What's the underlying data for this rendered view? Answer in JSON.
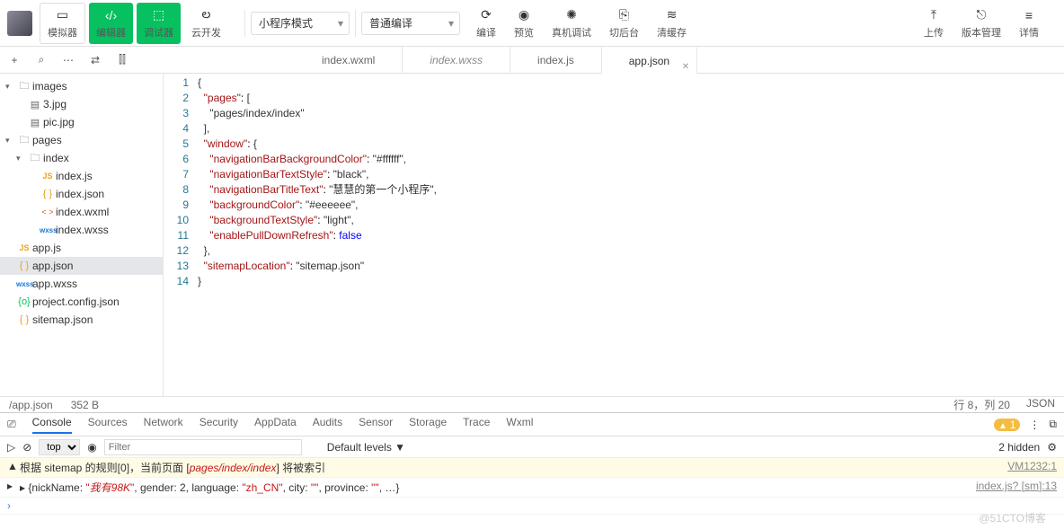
{
  "toolbar": {
    "simulator": "模拟器",
    "editor": "编辑器",
    "debugger": "调试器",
    "cloud": "云开发",
    "mode_select": "小程序模式",
    "compile_select": "普通编译",
    "compile": "编译",
    "preview": "预览",
    "remote_debug": "真机调试",
    "background": "切后台",
    "clear_cache": "清缓存",
    "upload": "上传",
    "version": "版本管理",
    "details": "详情"
  },
  "tabs": [
    {
      "label": "index.wxml",
      "active": false
    },
    {
      "label": "index.wxss",
      "active": false,
      "italic": true
    },
    {
      "label": "index.js",
      "active": false
    },
    {
      "label": "app.json",
      "active": true,
      "closable": true
    }
  ],
  "tree": [
    {
      "name": "images",
      "type": "folder",
      "open": true,
      "indent": 0
    },
    {
      "name": "3.jpg",
      "type": "img",
      "indent": 1
    },
    {
      "name": "pic.jpg",
      "type": "img",
      "indent": 1
    },
    {
      "name": "pages",
      "type": "folder",
      "open": true,
      "indent": 0
    },
    {
      "name": "index",
      "type": "folder",
      "open": true,
      "indent": 1
    },
    {
      "name": "index.js",
      "type": "js",
      "indent": 2
    },
    {
      "name": "index.json",
      "type": "json",
      "indent": 2
    },
    {
      "name": "index.wxml",
      "type": "wxml",
      "indent": 2
    },
    {
      "name": "index.wxss",
      "type": "wxss",
      "indent": 2
    },
    {
      "name": "app.js",
      "type": "js",
      "indent": 0
    },
    {
      "name": "app.json",
      "type": "json",
      "indent": 0,
      "selected": true
    },
    {
      "name": "app.wxss",
      "type": "wxss",
      "indent": 0
    },
    {
      "name": "project.config.json",
      "type": "config",
      "indent": 0
    },
    {
      "name": "sitemap.json",
      "type": "json",
      "indent": 0
    }
  ],
  "code_lines": [
    "{",
    "  \"pages\": [",
    "    \"pages/index/index\"",
    "  ],",
    "  \"window\": {",
    "    \"navigationBarBackgroundColor\": \"#ffffff\",",
    "    \"navigationBarTextStyle\": \"black\",",
    "    \"navigationBarTitleText\": \"慧慧的第一个小程序\",",
    "    \"backgroundColor\": \"#eeeeee\",",
    "    \"backgroundTextStyle\": \"light\",",
    "    \"enablePullDownRefresh\": false",
    "  },",
    "  \"sitemapLocation\": \"sitemap.json\"",
    "}"
  ],
  "status": {
    "path": "/app.json",
    "size": "352 B",
    "pos": "行 8，列 20",
    "lang": "JSON"
  },
  "console": {
    "tabs": [
      "Console",
      "Sources",
      "Network",
      "Security",
      "AppData",
      "Audits",
      "Sensor",
      "Storage",
      "Trace",
      "Wxml"
    ],
    "active_tab": "Console",
    "warn_count": "1",
    "scope": "top",
    "filter_placeholder": "Filter",
    "levels": "Default levels ▼",
    "hidden": "2 hidden",
    "rows": [
      {
        "type": "warn",
        "msg_pre": "根据 sitemap 的规则[0]，当前页面 [",
        "msg_hi": "pages/index/index",
        "msg_post": "] 将被索引",
        "src": "VM1232:1"
      },
      {
        "type": "log",
        "msg": "▸ {nickName: \"我有98K\", gender: 2, language: \"zh_CN\", city: \"\", province: \"\", …}",
        "src": "index.js? [sm]:13"
      }
    ]
  },
  "watermark": "@51CTO博客"
}
